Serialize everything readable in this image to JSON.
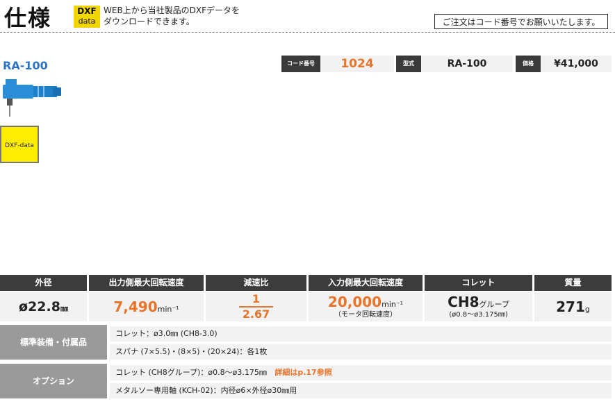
{
  "header": {
    "title": "仕様",
    "dxf_badge_line1": "DXF",
    "dxf_badge_line2": "data",
    "dxf_text_line1": "WEB上から当社製品のDXFデータを",
    "dxf_text_line2": "ダウンロードできます。",
    "order_note": "ご注文はコード番号でお願いいたします。"
  },
  "product": {
    "model_name": "RA-100",
    "dxf_box_label": "DXF-data"
  },
  "spec_chips": {
    "code_label": "コード番号",
    "code_value": "1024",
    "type_label": "型式",
    "type_value": "RA-100",
    "price_label": "価格",
    "price_value": "¥41,000"
  },
  "spec_table": {
    "headers": [
      "外径",
      "出力側最大回転速度",
      "減速比",
      "入力側最大回転速度",
      "コレット",
      "質量"
    ],
    "outer_diameter": {
      "value": "ø22.8",
      "unit": "㎜"
    },
    "output_speed": {
      "value": "7,490",
      "unit": "min⁻¹"
    },
    "ratio": {
      "numerator": "1",
      "denominator": "2.67"
    },
    "input_speed": {
      "value": "20,000",
      "unit": "min⁻¹",
      "note": "（モータ回転速度）"
    },
    "collet": {
      "value": "CH8",
      "suffix": "グループ",
      "range": "(ø0.8〜ø3.175㎜)"
    },
    "mass": {
      "value": "271",
      "unit": "g"
    }
  },
  "standard_accessories": {
    "label": "標準装備・付属品",
    "items": [
      "コレット：ø3.0㎜ (CH8-3.0)",
      "スパナ (7×5.5)・(8×5)・(20×24)：各1枚"
    ]
  },
  "options": {
    "label": "オプション",
    "items": [
      "コレット (CH8グループ)：ø0.8〜ø3.175㎜",
      "メタルソー専用軸 (KCH-02)：内径ø6×外径ø30㎜用"
    ],
    "detail_link": "詳細はp.17参照"
  },
  "colors": {
    "accent_orange": "#e8742a",
    "model_blue": "#2b74c4",
    "dxf_yellow": "#f2d600",
    "header_dark": "#3c3c3c",
    "row_label_gray": "#9a9a9a"
  }
}
